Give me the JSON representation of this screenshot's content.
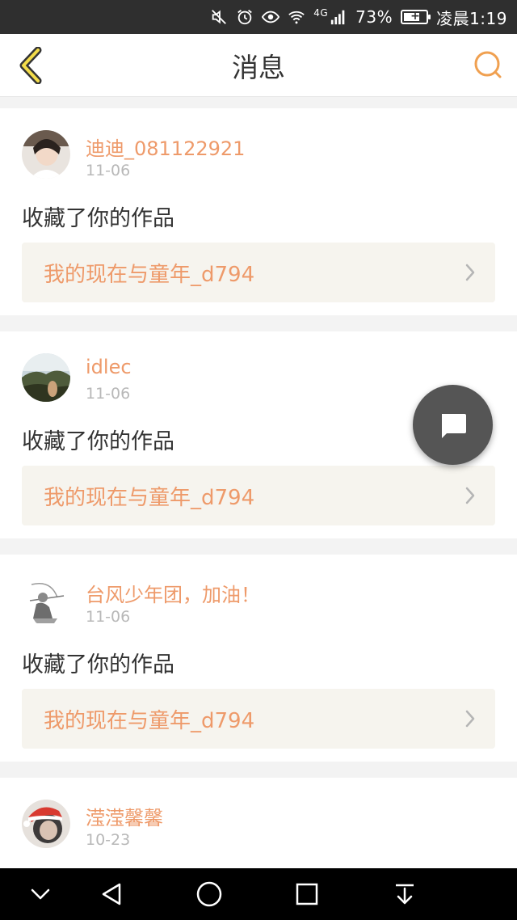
{
  "status_bar": {
    "network": "4G",
    "battery_percent": "73%",
    "time": "凌晨1:19",
    "icons": [
      "mute-icon",
      "alarm-icon",
      "eye-icon",
      "wifi-icon",
      "signal-icon",
      "battery-icon"
    ],
    "battery_level": 0.73
  },
  "header": {
    "title": "消息",
    "back_icon": "chevron-left-icon",
    "search_icon": "search-icon",
    "accent": "#f0a050"
  },
  "messages": [
    {
      "username": "迪迪_081122921",
      "date": "11-06",
      "action": "收藏了你的作品",
      "work_title": "我的现在与童年_d794"
    },
    {
      "username": "idlec",
      "date": "11-06",
      "action": "收藏了你的作品",
      "work_title": "我的现在与童年_d794"
    },
    {
      "username": "台风少年团，加油！",
      "date": "11-06",
      "action": "收藏了你的作品",
      "work_title": "我的现在与童年_d794"
    },
    {
      "username": "滢滢馨馨",
      "date": "10-23"
    }
  ],
  "colors": {
    "accent_text": "#ee9a6a",
    "date_text": "#b8b8b8",
    "card_link_bg": "#f6f4ee",
    "fab_bg": "#555555"
  },
  "fab_icon": "chat-bubble-icon",
  "nav_bar": {
    "icons": [
      "chevron-down-icon",
      "back-triangle-icon",
      "home-circle-icon",
      "recents-square-icon",
      "pull-down-icon"
    ]
  }
}
